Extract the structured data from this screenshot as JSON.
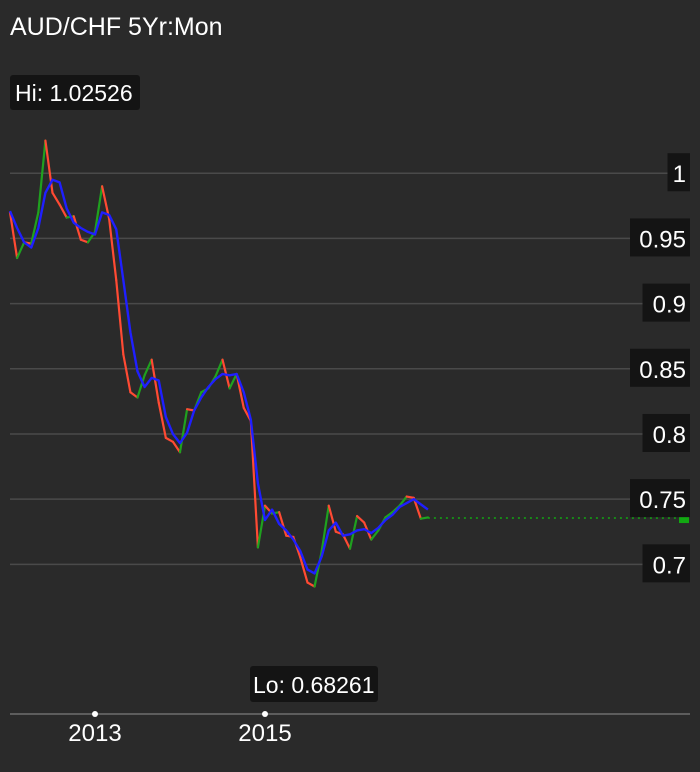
{
  "chart_data": {
    "type": "line",
    "title": "AUD/CHF 5Yr:Mon",
    "hi_label": "Hi: 1.02526",
    "lo_label": "Lo: 0.68261",
    "ylim": [
      0.655,
      1.037
    ],
    "y_ticks": [
      {
        "value": 0.7,
        "label": "0.7"
      },
      {
        "value": 0.75,
        "label": "0.75"
      },
      {
        "value": 0.8,
        "label": "0.8"
      },
      {
        "value": 0.85,
        "label": "0.85"
      },
      {
        "value": 0.9,
        "label": "0.9"
      },
      {
        "value": 0.95,
        "label": "0.95"
      },
      {
        "value": 1.0,
        "label": "1"
      }
    ],
    "xlim": [
      0,
      96
    ],
    "x_ticks": [
      {
        "index": 12,
        "label": "2013"
      },
      {
        "index": 36,
        "label": "2015"
      }
    ],
    "last_value": 0.7355,
    "grid": true,
    "colors": {
      "up": "#1fa11f",
      "down": "#ff4a33",
      "moving_average": "#1f1fff",
      "last_marker": "#12a812",
      "grid": "#4a4a4a",
      "background": "#2a2a2a"
    },
    "series": [
      {
        "x": [
          0,
          1,
          2,
          3,
          4,
          5,
          6,
          7,
          8,
          9,
          10,
          11,
          12,
          13,
          14,
          15,
          16,
          17,
          18,
          19,
          20,
          21,
          22,
          23,
          24,
          25,
          26,
          27,
          28,
          29,
          30,
          31,
          32,
          33,
          34,
          35,
          36,
          37,
          38,
          39,
          40,
          41,
          42,
          43,
          44,
          45,
          46,
          47,
          48,
          49,
          50,
          51,
          52,
          53,
          54,
          55,
          56,
          57,
          58,
          59
        ],
        "values": [
          0.97,
          0.935,
          0.947,
          0.946,
          0.97,
          1.025,
          0.985,
          0.976,
          0.966,
          0.967,
          0.949,
          0.947,
          0.955,
          0.99,
          0.965,
          0.918,
          0.861,
          0.832,
          0.828,
          0.845,
          0.857,
          0.824,
          0.797,
          0.794,
          0.786,
          0.819,
          0.818,
          0.832,
          0.835,
          0.844,
          0.857,
          0.835,
          0.846,
          0.82,
          0.81,
          0.713,
          0.745,
          0.739,
          0.74,
          0.722,
          0.721,
          0.705,
          0.686,
          0.683,
          0.71,
          0.745,
          0.725,
          0.723,
          0.712,
          0.737,
          0.732,
          0.719,
          0.726,
          0.736,
          0.74,
          0.745,
          0.752,
          0.751,
          0.735,
          0.736
        ]
      },
      {
        "values": [
          0.971,
          0.958,
          0.947,
          0.943,
          0.958,
          0.985,
          0.995,
          0.993,
          0.973,
          0.962,
          0.958,
          0.955,
          0.953,
          0.97,
          0.968,
          0.957,
          0.918,
          0.878,
          0.848,
          0.836,
          0.843,
          0.841,
          0.813,
          0.8,
          0.793,
          0.801,
          0.818,
          0.828,
          0.836,
          0.842,
          0.846,
          0.845,
          0.846,
          0.832,
          0.811,
          0.762,
          0.734,
          0.742,
          0.731,
          0.726,
          0.719,
          0.71,
          0.696,
          0.693,
          0.706,
          0.726,
          0.732,
          0.722,
          0.723,
          0.726,
          0.727,
          0.724,
          0.728,
          0.734,
          0.738,
          0.744,
          0.747,
          0.75,
          0.746,
          0.742
        ]
      }
    ]
  }
}
